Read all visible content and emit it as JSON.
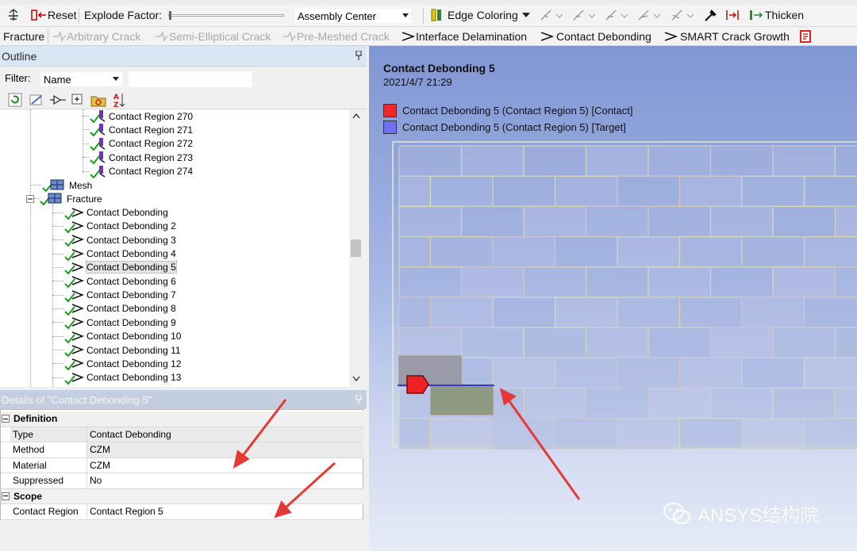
{
  "toolbar1": {
    "reset_label": "Reset",
    "explode_label": "Explode Factor:",
    "assembly_value": "Assembly Center",
    "edge_coloring_label": "Edge Coloring",
    "thicken_label": "Thicken"
  },
  "toolbar2": {
    "fracture_label": "Fracture",
    "arbitrary_crack": "Arbitrary Crack",
    "semi_elliptical_crack": "Semi-Elliptical Crack",
    "premeshed_crack": "Pre-Meshed Crack",
    "interface_delamination": "Interface Delamination",
    "contact_debonding": "Contact Debonding",
    "smart_crack_growth": "SMART Crack Growth"
  },
  "outline": {
    "title": "Outline",
    "filter_label": "Filter:",
    "filter_value": "Name",
    "search_value": "",
    "tree": {
      "contact_regions": [
        "Contact Region 270",
        "Contact Region 271",
        "Contact Region 272",
        "Contact Region 273",
        "Contact Region 274"
      ],
      "mesh_label": "Mesh",
      "fracture_label": "Fracture",
      "debonds": [
        "Contact Debonding",
        "Contact Debonding 2",
        "Contact Debonding 3",
        "Contact Debonding 4",
        "Contact Debonding 5",
        "Contact Debonding 6",
        "Contact Debonding 7",
        "Contact Debonding 8",
        "Contact Debonding 9",
        "Contact Debonding 10",
        "Contact Debonding 11",
        "Contact Debonding 12",
        "Contact Debonding 13"
      ],
      "selected_index": 4
    }
  },
  "details": {
    "title": "Details of \"Contact Debonding 5\"",
    "definition_label": "Definition",
    "rows_def": [
      {
        "k": "Type",
        "v": "Contact Debonding"
      },
      {
        "k": "Method",
        "v": "CZM"
      },
      {
        "k": "Material",
        "v": "CZM"
      },
      {
        "k": "Suppressed",
        "v": "No"
      }
    ],
    "scope_label": "Scope",
    "rows_scope": [
      {
        "k": "Contact Region",
        "v": "Contact Region 5"
      }
    ]
  },
  "viewport": {
    "title": "Contact Debonding 5",
    "date": "2021/4/7 21:29",
    "legend": [
      {
        "label": "Contact Debonding 5 (Contact Region 5) [Contact]",
        "color": "#ee2a2a"
      },
      {
        "label": "Contact Debonding 5 (Contact Region 5) [Target]",
        "color": "#6f6ff0"
      }
    ],
    "watermark": "ANSYS结构院"
  },
  "colors": {
    "annotation_red": "#e53935",
    "check_green": "#1a9e1a"
  }
}
